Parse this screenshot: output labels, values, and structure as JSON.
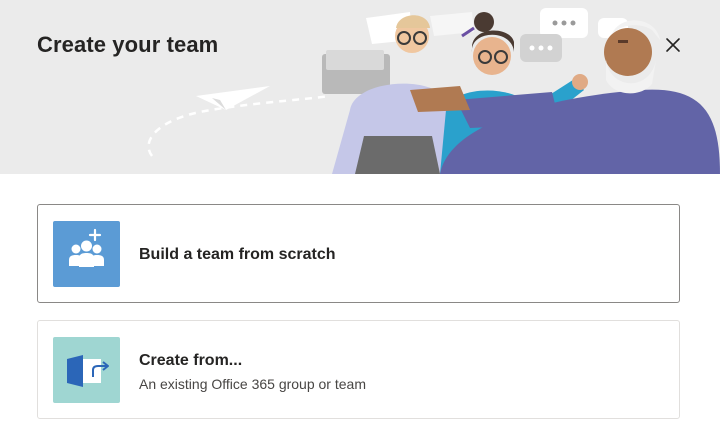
{
  "dialog": {
    "title": "Create your team",
    "close_icon": "close-icon"
  },
  "options": [
    {
      "title": "Build a team from scratch",
      "icon": "team-add-icon",
      "tile_color": "#5b9bd5"
    },
    {
      "title": "Create from...",
      "subtitle": "An existing Office 365 group or team",
      "icon": "create-from-icon",
      "tile_color": "#9fd6d2"
    }
  ],
  "colors": {
    "header_bg": "#ebebeb",
    "text_primary": "#252423",
    "selected_border": "#8a8886"
  }
}
